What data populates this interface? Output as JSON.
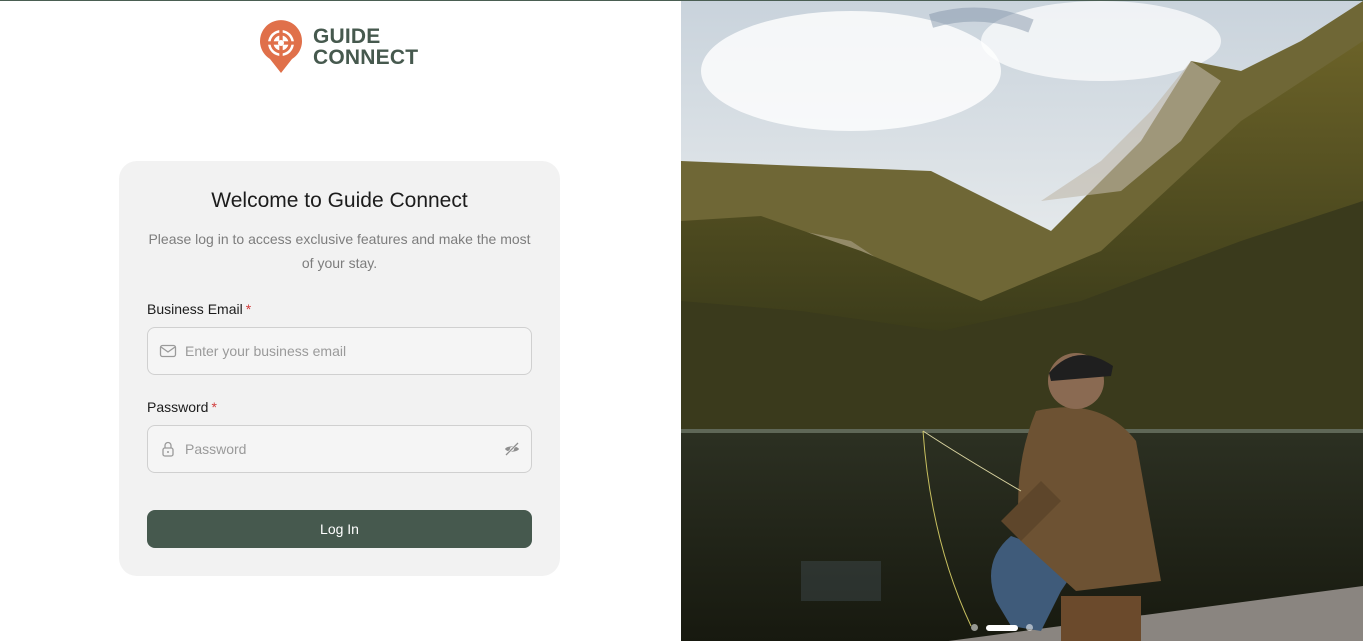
{
  "brand": {
    "line1": "GUIDE",
    "line2": "CONNECT",
    "logo_icon": "crosshair-pin-icon",
    "colors": {
      "primary": "#46594e",
      "accent": "#e0704a"
    }
  },
  "login": {
    "title": "Welcome to Guide Connect",
    "subtitle": "Please log in to access exclusive features and make the most of your stay.",
    "email": {
      "label": "Business Email",
      "required_mark": "*",
      "placeholder": "Enter your business email",
      "value": "",
      "icon": "mail-icon"
    },
    "password": {
      "label": "Password",
      "required_mark": "*",
      "placeholder": "Password",
      "value": "",
      "icon": "lock-icon",
      "toggle_icon": "eye-off-icon"
    },
    "submit_label": "Log In"
  },
  "carousel": {
    "slide_count": 3,
    "active_index": 1
  }
}
